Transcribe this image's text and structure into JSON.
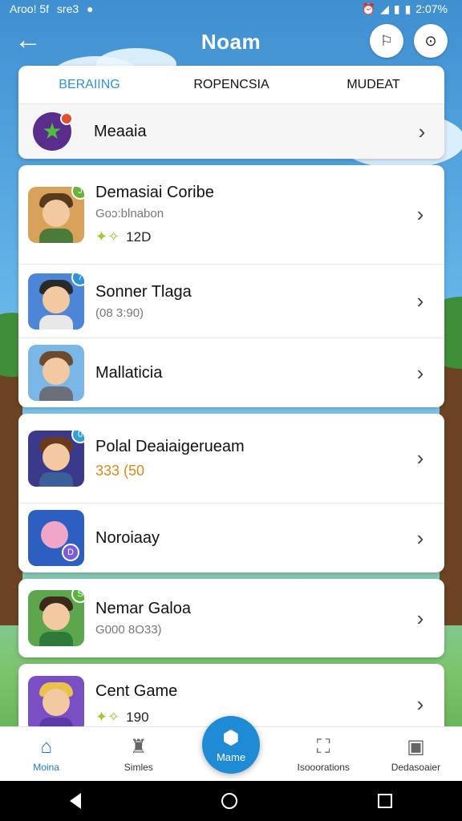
{
  "status": {
    "carrier": "Aroo! 5f",
    "carrier2": "sre3",
    "time": "2:07%"
  },
  "header": {
    "title": "Nᴏam"
  },
  "tabs": [
    "BERAIING",
    "ROPENCSIA",
    "MUDEAT"
  ],
  "featured": {
    "label": "Meaaia"
  },
  "games": [
    {
      "name": "Demasiai Coribe",
      "sub": "Goɔ:blnabon",
      "stat": "12D",
      "corner": "J"
    },
    {
      "name": "Sonner Tlaga",
      "sub": "(08 3:90)",
      "corner": "7"
    },
    {
      "name": "Mallaticia"
    },
    {
      "name": "Polal Deaiaigerueam",
      "stat_orange": "333 (50",
      "corner": "0"
    },
    {
      "name": "Noroiaay"
    },
    {
      "name": "Nemar Galoa",
      "sub": "G000 8O33)",
      "corner": "S"
    },
    {
      "name": "Cent Game",
      "stat": "190"
    }
  ],
  "bottom_nav": [
    {
      "label": "Moina"
    },
    {
      "label": "Simles"
    },
    {
      "label": "Mame"
    },
    {
      "label": "Isooorations"
    },
    {
      "label": "Dedasoaier"
    }
  ]
}
